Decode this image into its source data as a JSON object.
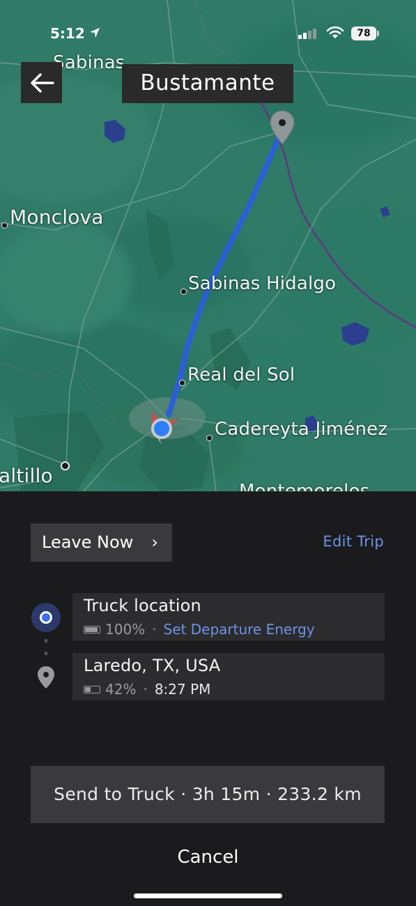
{
  "status_bar": {
    "time": "5:12",
    "battery": "78"
  },
  "header": {
    "title": "Bustamante"
  },
  "map": {
    "cities": {
      "sabinas": "Sabinas",
      "monclova": "Monclova",
      "sabinas_hidalgo": "Sabinas Hidalgo",
      "real_del_sol": "Real del Sol",
      "cadereyta": "Cadereyta Jiménez",
      "saltillo": "altillo",
      "montemorelos": "Montemorelos"
    },
    "route_color": "#2c5fd6"
  },
  "trip": {
    "leave_label": "Leave Now",
    "edit_label": "Edit Trip",
    "origin": {
      "name": "Truck location",
      "battery": "100%",
      "action": "Set Departure Energy"
    },
    "destination": {
      "name": "Laredo, TX, USA",
      "battery": "42%",
      "arrival": "8:27 PM"
    },
    "send_label": "Send to Truck · 3h 15m · 233.2 km",
    "cancel_label": "Cancel"
  },
  "colors": {
    "accent": "#6f92e6",
    "panel": "#1b1b1d",
    "button": "#3a3a3c"
  },
  "icons": [
    "back-arrow-icon",
    "location-arrow-icon",
    "cell-signal-icon",
    "wifi-icon",
    "battery-icon",
    "pin-icon",
    "chevron-right-icon"
  ]
}
